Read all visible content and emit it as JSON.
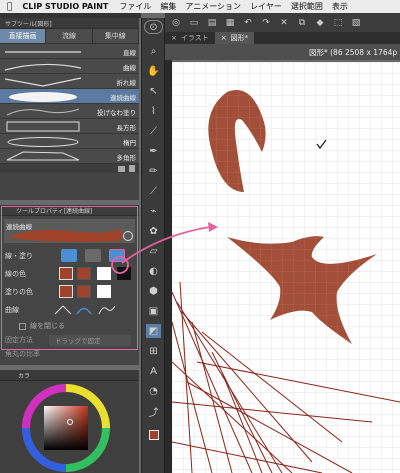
{
  "menubar": {
    "apple": "",
    "app": "CLIP STUDIO PAINT",
    "items": [
      "ファイル",
      "編集",
      "アニメーション",
      "レイヤー",
      "選択範囲",
      "表示"
    ]
  },
  "sub_tool": {
    "title": "サブツール[図形]",
    "tabs": [
      "直接描画",
      "流線",
      "集中線"
    ],
    "brushes": [
      "直線",
      "曲線",
      "折れ線",
      "連続曲線",
      "投げなわ塗り",
      "長方形",
      "楕円",
      "多角形"
    ],
    "selected_brush": "連続曲線"
  },
  "tool_property": {
    "title": "ツールプロパティ[連続曲線]",
    "name": "連続曲線",
    "rows": {
      "line_fill": "線・塗り",
      "line_color": "線の色",
      "fill_color": "塗りの色",
      "curve": "曲線",
      "close_line": "線を閉じる",
      "adjust": "固定方法",
      "adjust_value": "ドラッグで固定",
      "bottom": "角丸の比率"
    },
    "colors": {
      "brown": "#a0432a",
      "blue": "#4a8fd6",
      "pink": "#e2649b"
    }
  },
  "color_panel": {
    "title": "カラ"
  },
  "document": {
    "tabs": [
      "イラスト",
      "図形*"
    ],
    "active_tab": "図形*",
    "header": "図形* (86 2508 x 1764p"
  },
  "toolbar": {
    "icons": [
      "navigator-icon",
      "zoom-icon",
      "hand-icon",
      "select-icon",
      "lasso-icon",
      "eyedropper-icon",
      "pen-icon",
      "pencil-icon",
      "brush-icon",
      "airbrush-icon",
      "decoration-icon",
      "eraser-icon",
      "blend-icon",
      "fill-icon",
      "gradient-icon",
      "figure-icon",
      "ruler-icon",
      "text-icon",
      "balloon-icon",
      "correction-icon",
      "color-icon"
    ]
  }
}
